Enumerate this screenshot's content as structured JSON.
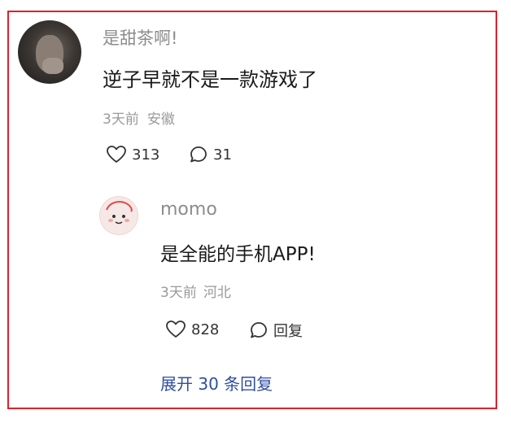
{
  "comment": {
    "username": "是甜茶啊!",
    "text": "逆子早就不是一款游戏了",
    "time": "3天前",
    "location": "安徽",
    "likes": "313",
    "replies": "31"
  },
  "reply": {
    "username": "momo",
    "text": "是全能的手机APP!",
    "time": "3天前",
    "location": "河北",
    "likes": "828",
    "reply_label": "回复"
  },
  "expand_label": "展开 30 条回复",
  "colors": {
    "frame": "#e0202a",
    "link": "#2f4f9e",
    "meta": "#9a9a9a"
  },
  "icons": {
    "like": "heart-icon",
    "comment": "comment-bubble-icon"
  }
}
